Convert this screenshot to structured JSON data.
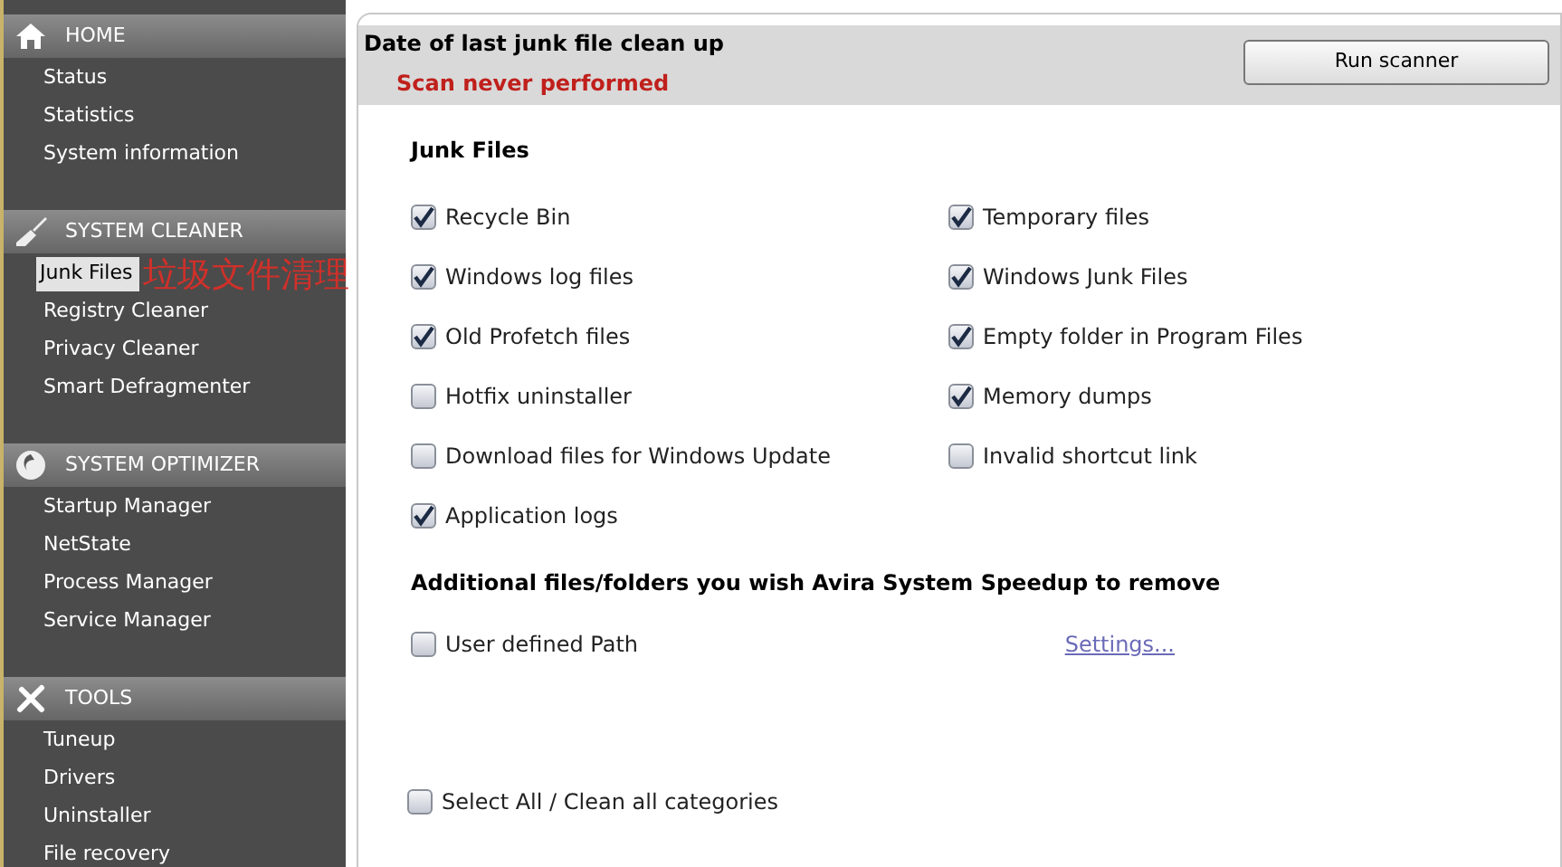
{
  "sidebar": {
    "sections": [
      {
        "title": "HOME",
        "items": [
          {
            "label": "Status",
            "selected": false
          },
          {
            "label": "Statistics",
            "selected": false
          },
          {
            "label": "System information",
            "selected": false
          }
        ]
      },
      {
        "title": "SYSTEM CLEANER",
        "items": [
          {
            "label": "Junk Files",
            "selected": true,
            "annotation": "垃圾文件清理"
          },
          {
            "label": "Registry Cleaner",
            "selected": false
          },
          {
            "label": "Privacy Cleaner",
            "selected": false
          },
          {
            "label": "Smart Defragmenter",
            "selected": false
          }
        ]
      },
      {
        "title": "SYSTEM OPTIMIZER",
        "items": [
          {
            "label": "Startup Manager",
            "selected": false
          },
          {
            "label": "NetState",
            "selected": false
          },
          {
            "label": "Process Manager",
            "selected": false
          },
          {
            "label": "Service Manager",
            "selected": false
          }
        ]
      },
      {
        "title": "TOOLS",
        "items": [
          {
            "label": "Tuneup",
            "selected": false
          },
          {
            "label": "Drivers",
            "selected": false
          },
          {
            "label": "Uninstaller",
            "selected": false
          },
          {
            "label": "File recovery",
            "selected": false
          }
        ]
      }
    ]
  },
  "status": {
    "title": "Date of last junk file clean up",
    "message": "Scan never performed",
    "button": "Run scanner"
  },
  "junk_files": {
    "title": "Junk Files",
    "items": [
      {
        "label": "Recycle Bin",
        "checked": true
      },
      {
        "label": "Temporary files",
        "checked": true
      },
      {
        "label": "Windows log files",
        "checked": true
      },
      {
        "label": "Windows Junk Files",
        "checked": true
      },
      {
        "label": "Old Profetch files",
        "checked": true
      },
      {
        "label": "Empty folder in Program Files",
        "checked": true
      },
      {
        "label": "Hotfix uninstaller",
        "checked": false
      },
      {
        "label": "Memory dumps",
        "checked": true
      },
      {
        "label": "Download files for Windows Update",
        "checked": false
      },
      {
        "label": "Invalid shortcut link",
        "checked": false
      },
      {
        "label": "Application logs",
        "checked": true
      }
    ]
  },
  "additional": {
    "title": "Additional files/folders you wish Avira System Speedup to remove",
    "item": {
      "label": "User defined Path",
      "checked": false
    },
    "link": "Settings..."
  },
  "select_all": {
    "label": "Select All / Clean all categories",
    "checked": false
  }
}
